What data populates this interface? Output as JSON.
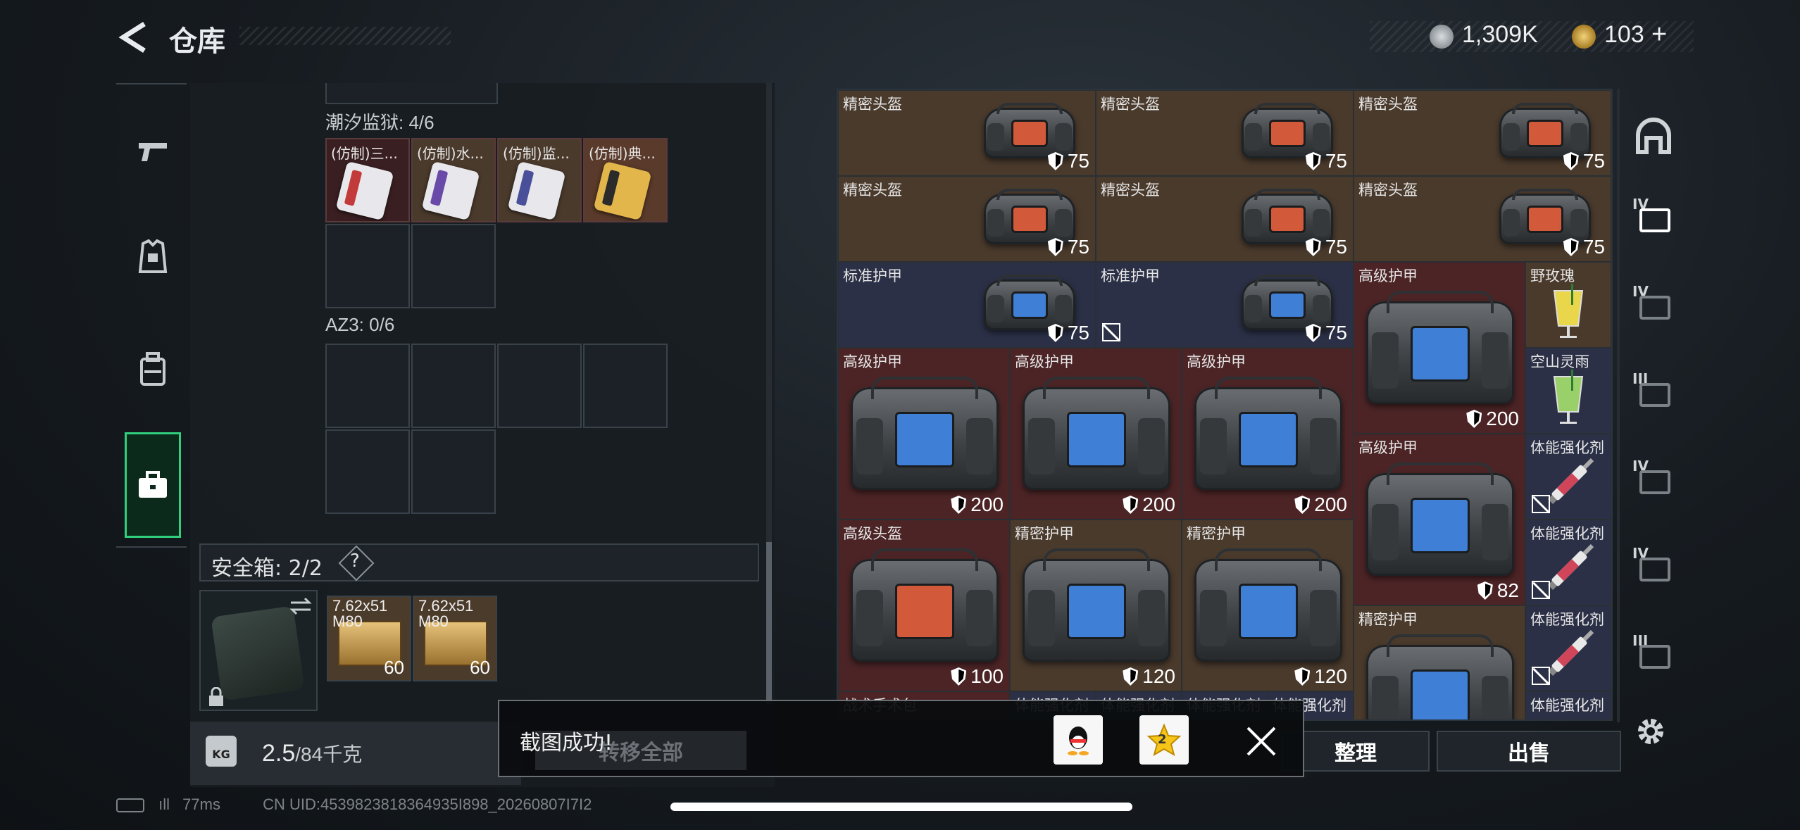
{
  "header": {
    "title": "仓库",
    "currency1": "1,309K",
    "currency2": "103",
    "plus": "+"
  },
  "left": {
    "section1_label": "潮汐监狱: 4/6",
    "section1_items": [
      {
        "name": "(仿制)三...",
        "stripe": "#c33a3a"
      },
      {
        "name": "(仿制)水...",
        "stripe": "#6a4aa8"
      },
      {
        "name": "(仿制)监...",
        "stripe": "#4a4f9a"
      },
      {
        "name": "(仿制)典...",
        "stripe": "#2b2b2b"
      }
    ],
    "section2_label": "AZ3: 0/6",
    "safe_label": "安全箱: 2/2",
    "help_q": "?",
    "ammo": [
      {
        "name": "7.62x51 M80",
        "count": "60"
      },
      {
        "name": "7.62x51 M80",
        "count": "60"
      }
    ],
    "kg_icon": "KG",
    "weight": "2.5",
    "weight_max": "/84千克"
  },
  "grid": {
    "cells": [
      {
        "name": "精密头盔",
        "dur": "75",
        "kind": "helmet",
        "bg": "#4a3a2c",
        "shield": true
      },
      {
        "name": "精密头盔",
        "dur": "75",
        "kind": "helmet",
        "bg": "#4a3a2c",
        "shield": true
      },
      {
        "name": "精密头盔",
        "dur": "75",
        "kind": "helmet",
        "bg": "#4a3a2c",
        "shield": true
      },
      {
        "name": "精密头盔",
        "dur": "75",
        "kind": "helmet",
        "bg": "#4a3a2c",
        "shield": true
      },
      {
        "name": "精密头盔",
        "dur": "75",
        "kind": "helmet",
        "bg": "#4a3a2c",
        "shield": true
      },
      {
        "name": "精密头盔",
        "dur": "75",
        "kind": "helmet",
        "bg": "#4a3a2c",
        "shield": true
      },
      {
        "name": "标准护甲",
        "dur": "75",
        "kind": "armor",
        "bg": "#2b3046",
        "shield": true
      },
      {
        "name": "标准护甲",
        "dur": "75",
        "kind": "armor",
        "bg": "#2b3046",
        "shield": true,
        "broken": true
      },
      {
        "name": "高级护甲",
        "dur": "200",
        "kind": "armor-big",
        "bg": "#4c2426",
        "shield": true
      },
      {
        "name": "野玫瑰",
        "dur": "",
        "kind": "drink-yellow",
        "bg": "#4a3a2c"
      },
      {
        "name": "空山灵雨",
        "dur": "",
        "kind": "drink-green",
        "bg": "#2b3046"
      },
      {
        "name": "高级护甲",
        "dur": "200",
        "kind": "armor-big",
        "bg": "#4c2426",
        "shield": true
      },
      {
        "name": "高级护甲",
        "dur": "200",
        "kind": "armor-big",
        "bg": "#4c2426",
        "shield": true
      },
      {
        "name": "高级护甲",
        "dur": "200",
        "kind": "armor-big",
        "bg": "#4c2426",
        "shield": true
      },
      {
        "name": "高级护甲",
        "dur": "82",
        "kind": "armor-big",
        "bg": "#4c2426",
        "shield": true
      },
      {
        "name": "体能强化剂",
        "dur": "",
        "kind": "syringe",
        "bg": "#2b3046",
        "broken": true
      },
      {
        "name": "高级头盔",
        "dur": "100",
        "kind": "helmet-big",
        "bg": "#4c2426",
        "shield": true
      },
      {
        "name": "精密护甲",
        "dur": "120",
        "kind": "armor-big",
        "bg": "#4a3a2c",
        "shield": true
      },
      {
        "name": "精密护甲",
        "dur": "120",
        "kind": "armor-big",
        "bg": "#4a3a2c",
        "shield": true
      },
      {
        "name": "体能强化剂",
        "dur": "",
        "kind": "syringe",
        "bg": "#2b3046",
        "broken": true
      },
      {
        "name": "精密护甲",
        "dur": "",
        "kind": "armor-big",
        "bg": "#4a3a2c"
      },
      {
        "name": "体能强化剂",
        "dur": "",
        "kind": "syringe",
        "bg": "#2b3046",
        "broken": true
      },
      {
        "name": "战术手术包",
        "dur": "",
        "kind": "empty",
        "bg": "#4c2426"
      },
      {
        "name": "体能强化剂",
        "dur": "",
        "kind": "empty",
        "bg": "#2b3046"
      },
      {
        "name": "体能强化剂",
        "dur": "",
        "kind": "empty",
        "bg": "#2b3046"
      },
      {
        "name": "体能强化剂",
        "dur": "",
        "kind": "empty",
        "bg": "#2b3046"
      },
      {
        "name": "体能强化剂",
        "dur": "",
        "kind": "empty",
        "bg": "#2b3046"
      },
      {
        "name": "体能强化剂",
        "dur": "",
        "kind": "empty",
        "bg": "#2b3046"
      }
    ]
  },
  "right_strip": {
    "labels": [
      "IV",
      "IV",
      "III",
      "IV",
      "IV",
      "III"
    ]
  },
  "buttons": {
    "sort": "整理",
    "sell": "出售"
  },
  "toast": {
    "text": "截图成功!",
    "transfer": "转移全部",
    "badge": "2"
  },
  "status": {
    "ping": "77ms",
    "uid": "CN UID:4539823818364935I898_20260807I7I2"
  },
  "colors": {
    "accent_green": "#2fcf7c"
  }
}
